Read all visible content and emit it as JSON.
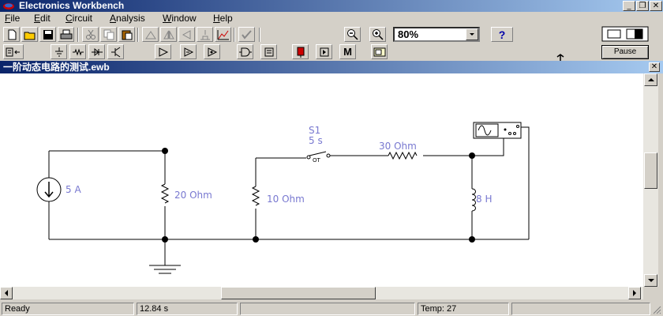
{
  "app": {
    "title": "Electronics Workbench"
  },
  "window_controls": {
    "minimize": "_",
    "restore": "❐",
    "close": "✕"
  },
  "menu": [
    {
      "label_before": "",
      "accel": "F",
      "label_after": "ile"
    },
    {
      "label_before": "",
      "accel": "E",
      "label_after": "dit"
    },
    {
      "label_before": "",
      "accel": "C",
      "label_after": "ircuit"
    },
    {
      "label_before": "",
      "accel": "A",
      "label_after": "nalysis"
    },
    {
      "label_before": "",
      "accel": "W",
      "label_after": "indow"
    },
    {
      "label_before": "",
      "accel": "H",
      "label_after": "elp"
    }
  ],
  "toolbar": {
    "zoom_value": "80%",
    "help_label": "?",
    "pause_label": "Pause",
    "icons": [
      "new-file-icon",
      "open-folder-icon",
      "save-icon",
      "print-icon",
      "cut-icon",
      "copy-icon",
      "paste-icon",
      "rotate-icon",
      "flip-horizontal-icon",
      "flip-vertical-icon",
      "component-properties-icon",
      "graph-icon",
      "create-subcircuit-icon",
      "zoom-out-icon",
      "zoom-in-icon",
      "help-icon",
      "power-switch-icon"
    ]
  },
  "parts_bin": {
    "icons": [
      "parts-bin-menu-icon",
      "sources-icon",
      "basic-components-icon",
      "diodes-icon",
      "transistors-icon",
      "analog-ics-icon",
      "mixed-ics-icon",
      "digital-ics-icon",
      "logic-gates-icon",
      "digital-icon",
      "indicators-icon",
      "controls-icon",
      "miscellaneous-icon",
      "instruments-icon"
    ],
    "m_label": "M"
  },
  "document": {
    "title": "一阶动态电路的测试.ewb",
    "close": "✕"
  },
  "circuit": {
    "source_label": "5 A",
    "r1_label": "20  Ohm",
    "r2_label": "10  Ohm",
    "r3_label": "30  Ohm",
    "inductor_label": "8 H",
    "switch_name": "S1",
    "switch_time": "5 s",
    "switch_tag": "OT"
  },
  "status": {
    "ready": "Ready",
    "time": "12.84 s",
    "blank1": "",
    "temp": "Temp:  27",
    "blank2": ""
  },
  "colors": {
    "title_start": "#0a246a",
    "title_end": "#a6caf0",
    "label_blue": "#7878d0",
    "wire": "#000000"
  }
}
